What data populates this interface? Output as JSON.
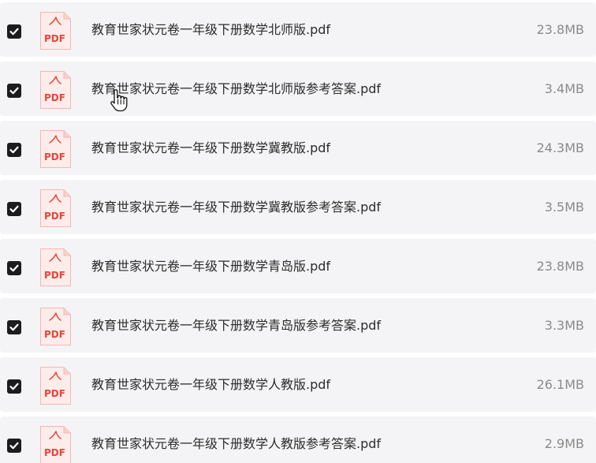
{
  "files": [
    {
      "name": "教育世家状元卷一年级下册数学北师版.pdf",
      "size": "23.8MB",
      "checked": true,
      "icon": "pdf-file-icon",
      "badge": "PDF"
    },
    {
      "name": "教育世家状元卷一年级下册数学北师版参考答案.pdf",
      "size": "3.4MB",
      "checked": true,
      "icon": "pdf-file-icon",
      "badge": "PDF"
    },
    {
      "name": "教育世家状元卷一年级下册数学冀教版.pdf",
      "size": "24.3MB",
      "checked": true,
      "icon": "pdf-file-icon",
      "badge": "PDF"
    },
    {
      "name": "教育世家状元卷一年级下册数学冀教版参考答案.pdf",
      "size": "3.5MB",
      "checked": true,
      "icon": "pdf-file-icon",
      "badge": "PDF"
    },
    {
      "name": "教育世家状元卷一年级下册数学青岛版.pdf",
      "size": "23.8MB",
      "checked": true,
      "icon": "pdf-file-icon",
      "badge": "PDF"
    },
    {
      "name": "教育世家状元卷一年级下册数学青岛版参考答案.pdf",
      "size": "3.3MB",
      "checked": true,
      "icon": "pdf-file-icon",
      "badge": "PDF"
    },
    {
      "name": "教育世家状元卷一年级下册数学人教版.pdf",
      "size": "26.1MB",
      "checked": true,
      "icon": "pdf-file-icon",
      "badge": "PDF"
    },
    {
      "name": "教育世家状元卷一年级下册数学人教版参考答案.pdf",
      "size": "2.9MB",
      "checked": true,
      "icon": "pdf-file-icon",
      "badge": "PDF"
    }
  ],
  "colors": {
    "row_background": "#f4f4f6",
    "checkbox_fill": "#1c1c1c",
    "pdf_red": "#e8453c",
    "pdf_light": "#fdecea",
    "filename_text": "#2b2b2b",
    "size_text": "#8a8a8a"
  },
  "cursor": {
    "icon": "hand-pointer-icon"
  }
}
